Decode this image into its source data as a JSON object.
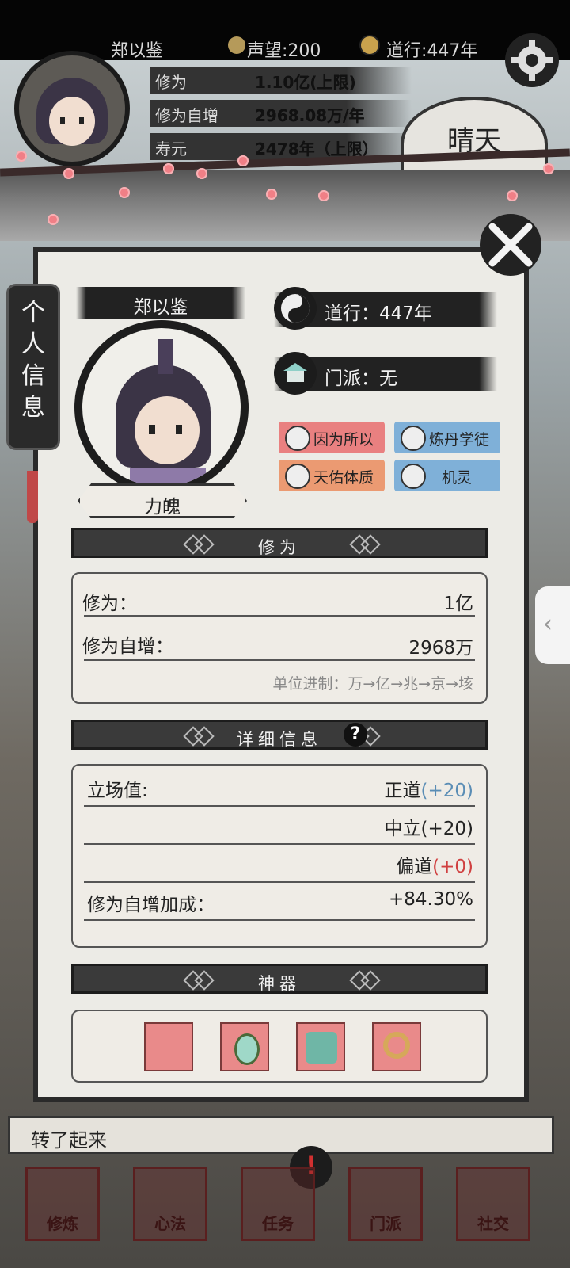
{
  "header": {
    "player_name": "郑以鉴",
    "reputation": "声望:200",
    "daoxing": "道行:447年",
    "stats": [
      {
        "label": "修为",
        "value": "1.10亿(上限)"
      },
      {
        "label": "修为自增",
        "value": "2968.08万/年"
      },
      {
        "label": "寿元",
        "value": "2478年（上限）"
      }
    ],
    "weather": "晴天"
  },
  "side_tab": {
    "label_lines": [
      "个",
      "人",
      "信",
      "息"
    ]
  },
  "profile": {
    "name": "郑以鉴",
    "daoxing": "道行：447年",
    "sect": "门派：无",
    "soul": "力魄",
    "traits": [
      {
        "label": "因为所以",
        "color": "#e98080"
      },
      {
        "label": "炼丹学徒",
        "color": "#7fb0d8"
      },
      {
        "label": "天佑体质",
        "color": "#eb9a72"
      },
      {
        "label": "机灵",
        "color": "#7fb0d8"
      }
    ]
  },
  "cultivation": {
    "title": "修为",
    "rows": [
      {
        "label": "修为：",
        "value": "1亿"
      },
      {
        "label": "修为自增：",
        "value": "2968万"
      }
    ],
    "unit_note": "单位进制：万→亿→兆→京→垓"
  },
  "details": {
    "title": "详细信息",
    "help": "?",
    "stance_label": "立场值:",
    "stance": [
      {
        "name": "正道",
        "delta": "(+20)",
        "delta_color": "#5a8db5"
      },
      {
        "name": "中立",
        "delta": "(+20)",
        "delta_color": "#222222"
      },
      {
        "name": "偏道",
        "delta": "(+0)",
        "delta_color": "#d04040"
      }
    ],
    "bonus_label": "修为自增加成：",
    "bonus_value": "+84.30%"
  },
  "artifacts": {
    "title": "神器",
    "icons": [
      "fan-icon",
      "mirror-icon",
      "seal-icon",
      "ring-icon"
    ]
  },
  "message": "转了起来",
  "nav": [
    "修炼",
    "心法",
    "任务",
    "门派",
    "社交"
  ]
}
